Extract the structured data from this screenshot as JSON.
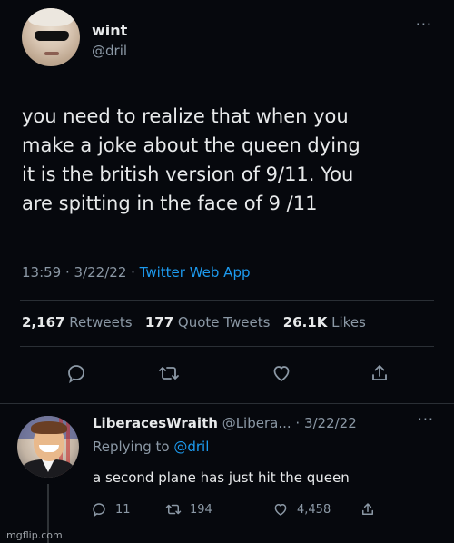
{
  "tweet": {
    "display_name": "wint",
    "handle": "@dril",
    "text": "you need to realize that when you\nmake a joke about the queen dying\nit is the british version of 9/11. You\nare spitting in the face of 9 /11",
    "time": "13:59 · 3/22/22 · ",
    "source": "Twitter Web App",
    "retweets_count": "2,167",
    "retweets_label": "Retweets",
    "quotes_count": "177",
    "quotes_label": "Quote Tweets",
    "likes_count": "26.1K",
    "likes_label": "Likes",
    "more_icon": "ellipsis-icon"
  },
  "reply": {
    "display_name": "LiberacesWraith",
    "handle_date": "@Libera... · 3/22/22",
    "replying_prefix": "Replying to ",
    "replying_mention": "@dril",
    "text": "a second plane has just hit the queen",
    "reply_count": "11",
    "retweet_count": "194",
    "like_count": "4,458"
  },
  "watermark": "imgflip.com",
  "colors": {
    "background": "#06080d",
    "text": "#e7e9ea",
    "secondary": "#8b98a5",
    "accent": "#1d9bf0",
    "divider": "#2a2f35"
  }
}
